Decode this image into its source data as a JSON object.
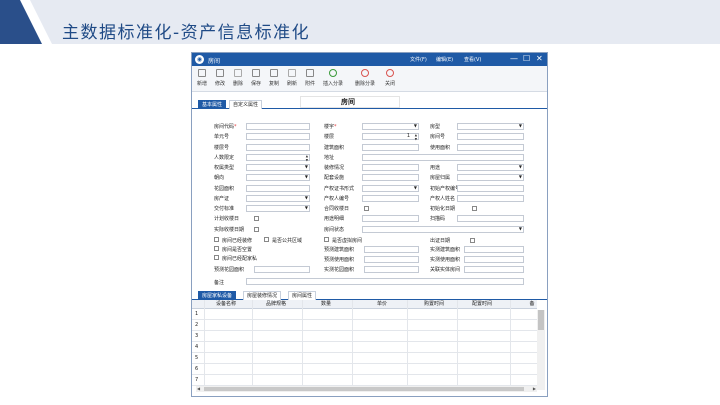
{
  "slide": {
    "title": "主数据标准化-资产信息标准化"
  },
  "window": {
    "title": "房间",
    "menus": [
      "文件(F)",
      "编辑(E)",
      "查看(V)"
    ],
    "controls": [
      "—",
      "☐",
      "✕"
    ]
  },
  "toolbar": [
    {
      "label": "新增",
      "icon": "new-icon"
    },
    {
      "label": "修改",
      "icon": "edit-icon"
    },
    {
      "label": "删除",
      "icon": "delete-icon"
    },
    {
      "label": "保存",
      "icon": "save-icon"
    },
    {
      "label": "复制",
      "icon": "copy-icon"
    },
    {
      "label": "刷新",
      "icon": "refresh-icon"
    },
    {
      "label": "附件",
      "icon": "attachment-icon"
    },
    {
      "label": "插入分录",
      "icon": "insert-row-icon"
    },
    {
      "label": "删除分录",
      "icon": "delete-row-icon"
    },
    {
      "label": "关闭",
      "icon": "close-icon"
    }
  ],
  "tabs_top": [
    "基本属性",
    "自定义属性"
  ],
  "form_heading": "房间",
  "form": {
    "col1": [
      "房间代码",
      "单元号",
      "楼层号",
      "人数限定",
      "权属类型",
      "朝向",
      "花园面积",
      "房产证",
      "交付标准",
      "计划收楼日",
      "实际收楼日期"
    ],
    "col2": [
      "楼宇",
      "楼层",
      "建筑面积",
      "装修情况",
      "配套设施",
      "产权证书形式",
      "产权人编号",
      "合同收楼日",
      "用途明细",
      "房间状态"
    ],
    "col3": [
      "房型",
      "房间号",
      "使用面积",
      "地址",
      "用途",
      "房屋归属",
      "初始产权编号",
      "产权人姓名",
      "初始化日期",
      "扫描码"
    ],
    "floor_value": "1",
    "checks": [
      "房间已经装修",
      "是否公共区域",
      "房间是否空置",
      "房间已经配家私",
      "是否虚拟房间"
    ],
    "lower_col1": [
      "预测花园面积"
    ],
    "lower_col2": [
      "预测建筑面积",
      "预测使用面积",
      "实测花园面积"
    ],
    "lower_col3": [
      "出证日期",
      "实测建筑面积",
      "实测使用面积",
      "关联实体房间"
    ],
    "remark": "备注"
  },
  "tabs_bottom": [
    "房屋家私设备",
    "房屋装修情况",
    "房间属性"
  ],
  "grid": {
    "columns": [
      "设备名称",
      "品牌规格",
      "数量",
      "单价",
      "购置时间",
      "配置时间",
      "备"
    ],
    "rows": [
      "1",
      "2",
      "3",
      "4",
      "5",
      "6",
      "7"
    ]
  }
}
